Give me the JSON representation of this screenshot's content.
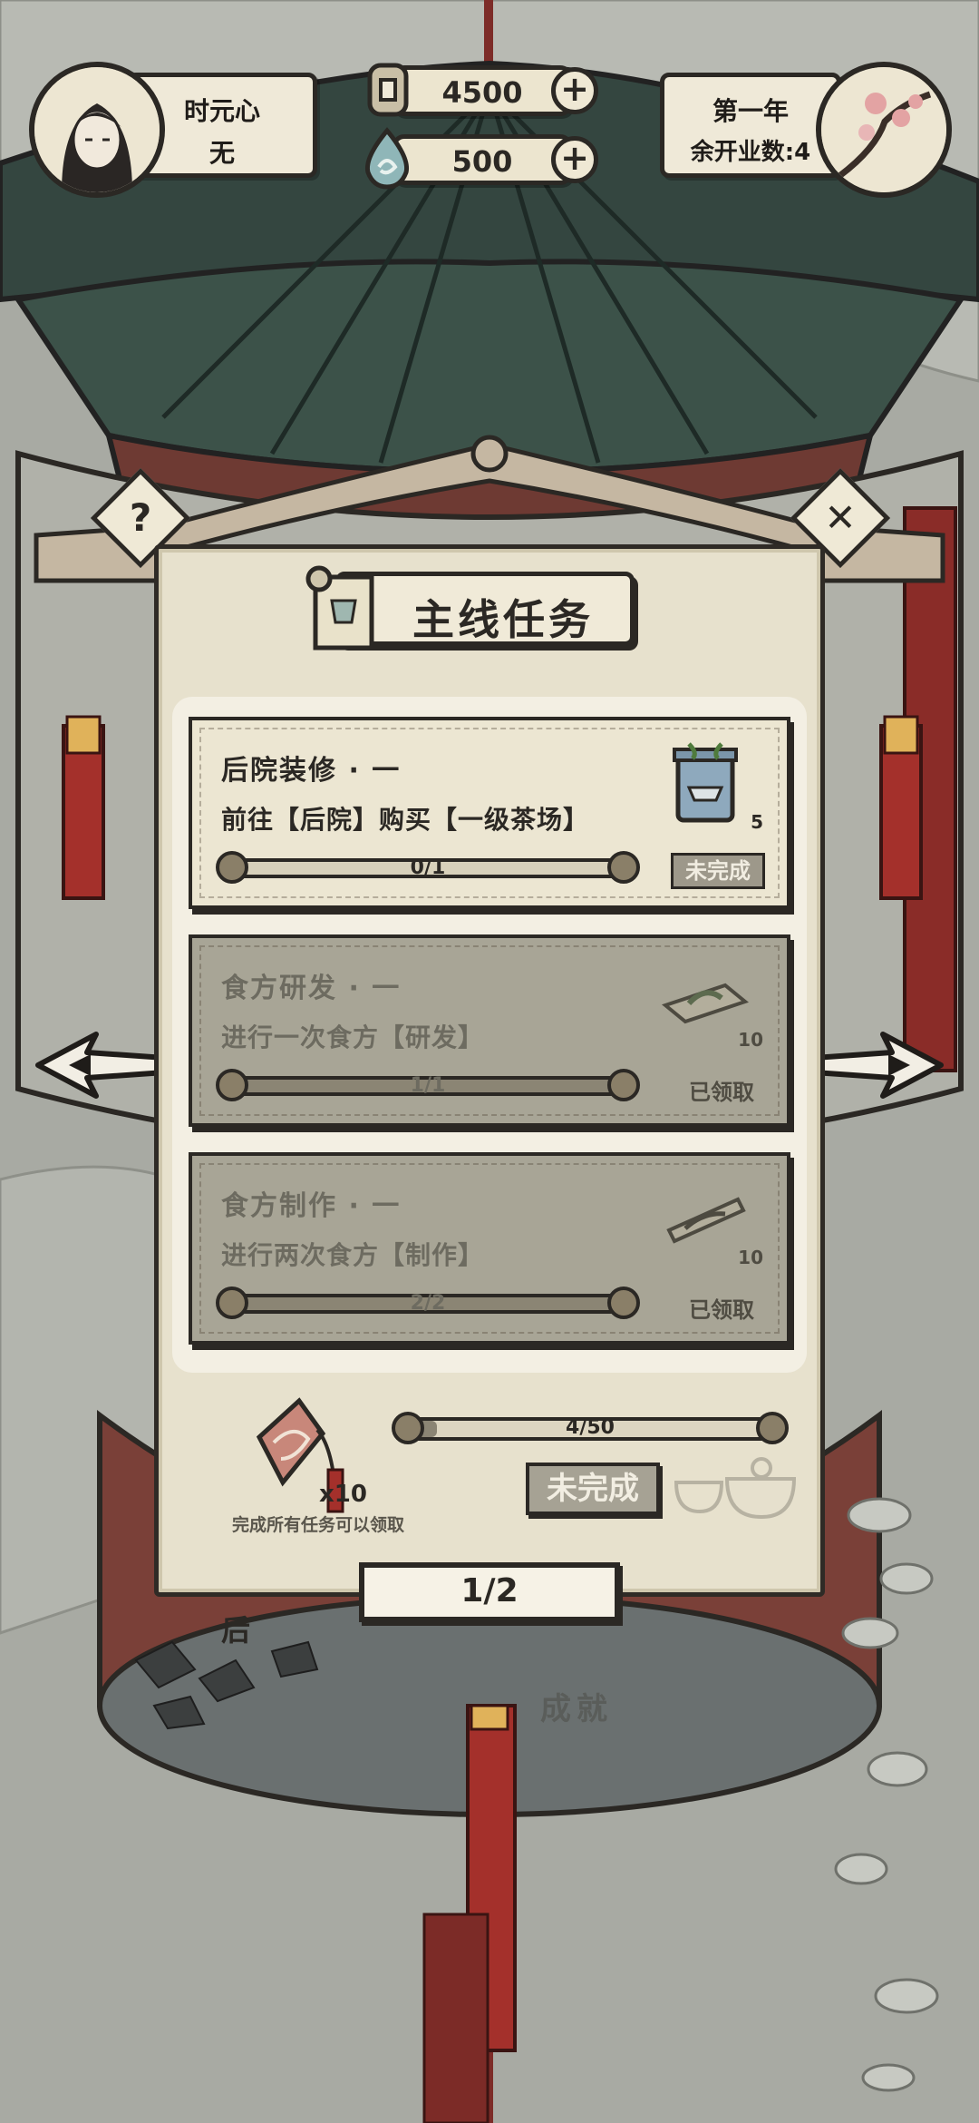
{
  "player": {
    "name": "时元心",
    "title": "无"
  },
  "currency": {
    "coins": "4500",
    "jade": "500"
  },
  "calendar": {
    "year": "第一年",
    "remaining_label": "余开业数:4"
  },
  "panel": {
    "title": "主线任务",
    "tasks": [
      {
        "title": "后院装修 · 一",
        "desc": "前往【后院】购买【一级茶场】",
        "progress_text": "0/1",
        "progress": 0.0,
        "reward_count": "5",
        "status": "未完成",
        "completed": false
      },
      {
        "title": "食方研发 · 一",
        "desc": "进行一次食方【研发】",
        "progress_text": "1/1",
        "progress": 1.0,
        "reward_count": "10",
        "status": "已领取",
        "completed": true
      },
      {
        "title": "食方制作 · 一",
        "desc": "进行两次食方【制作】",
        "progress_text": "2/2",
        "progress": 1.0,
        "reward_count": "10",
        "status": "已领取",
        "completed": true
      }
    ],
    "total": {
      "progress_text": "4/50",
      "progress": 0.08,
      "reward_count": "x10",
      "hint": "完成所有任务可以领取",
      "button": "未完成"
    },
    "pager": "1/2"
  },
  "background": {
    "left_label": "后",
    "center_label": "成就"
  },
  "colors": {
    "ink": "#2b2824",
    "paper": "#efe9d8",
    "tassel": "#a8302c",
    "roof": "#3e5048"
  },
  "icons": [
    "help-icon",
    "close-icon",
    "left-arrow-icon",
    "right-arrow-icon",
    "scroll-icon",
    "coin-icon",
    "jade-icon",
    "tea-tin-icon",
    "recipe-icon",
    "pendant-icon"
  ]
}
